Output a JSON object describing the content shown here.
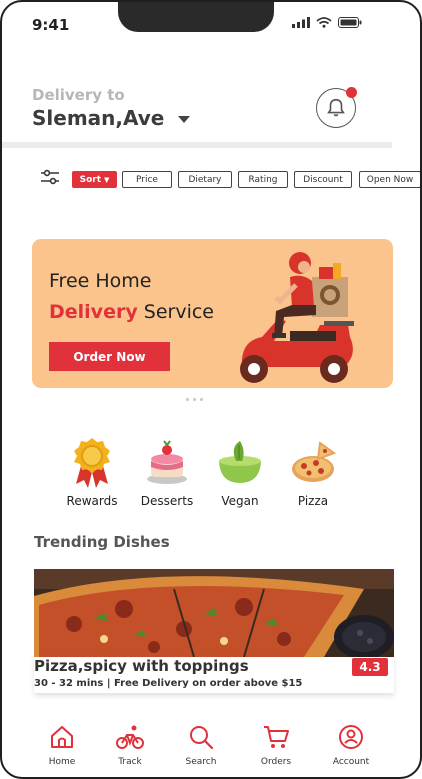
{
  "status_bar": {
    "time": "9:41"
  },
  "header": {
    "deliver_label": "Delivery to",
    "location": "Sleman,Ave"
  },
  "filters": {
    "sort": "Sort",
    "chips": [
      "Price",
      "Dietary",
      "Rating",
      "Discount",
      "Open Now"
    ]
  },
  "banner": {
    "line1": "Free Home",
    "line2_accent": "Delivery",
    "line2_rest": " Service",
    "button": "Order Now"
  },
  "categories": [
    {
      "label": "Rewards",
      "icon": "medal-icon"
    },
    {
      "label": "Desserts",
      "icon": "cake-icon"
    },
    {
      "label": "Vegan",
      "icon": "vegan-bowl-icon"
    },
    {
      "label": "Pizza",
      "icon": "pizza-icon"
    }
  ],
  "trending": {
    "title": "Trending Dishes",
    "dish_name": "Pizza,spicy with toppings",
    "dish_meta": "30 - 32 mins | Free Delivery on order above $15",
    "rating": "4.3"
  },
  "bottom_nav": [
    "Home",
    "Track",
    "Search",
    "Orders",
    "Account"
  ],
  "colors": {
    "accent": "#e1323b",
    "banner_bg": "#fbc48c"
  }
}
